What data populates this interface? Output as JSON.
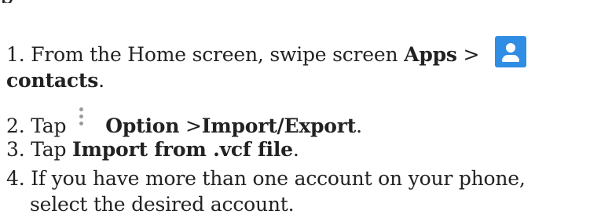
{
  "header_fragment": "p",
  "steps": [
    {
      "num": "1.",
      "pre": "From the Home screen, swipe screen ",
      "bold1": "Apps",
      "sep": " >",
      "icon": "contacts-icon",
      "bold2": "contacts",
      "end": "."
    },
    {
      "num": "2.",
      "pre": "Tap",
      "icon": "more-options-icon",
      "bold1": "Option",
      "sep": " >",
      "bold2": "Import/Export",
      "end": "."
    },
    {
      "num": "3.",
      "pre": "Tap ",
      "bold1": "Import from .vcf file",
      "end": "."
    },
    {
      "num": "4.",
      "text1": "If you have more than one account on your phone,",
      "text2": "select the desired account."
    }
  ],
  "colors": {
    "contacts_icon_bg": "#2f8de4",
    "menu_dots": "#9a9a9a",
    "text": "#222222"
  }
}
